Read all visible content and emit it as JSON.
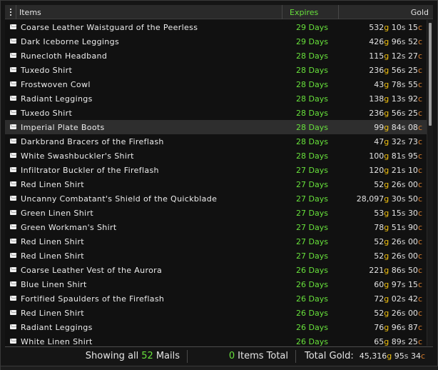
{
  "columns": {
    "items": "Items",
    "expires": "Expires",
    "gold": "Gold"
  },
  "rows": [
    {
      "name": "Coarse Leather Waistguard of the Peerless",
      "expires": "29 Days",
      "g": "532",
      "s": "10",
      "c": "15"
    },
    {
      "name": "Dark Iceborne Leggings",
      "expires": "29 Days",
      "g": "426",
      "s": "96",
      "c": "52"
    },
    {
      "name": "Runecloth Headband",
      "expires": "28 Days",
      "g": "115",
      "s": "12",
      "c": "27"
    },
    {
      "name": "Tuxedo Shirt",
      "expires": "28 Days",
      "g": "236",
      "s": "56",
      "c": "25"
    },
    {
      "name": "Frostwoven Cowl",
      "expires": "28 Days",
      "g": "43",
      "s": "78",
      "c": "55"
    },
    {
      "name": "Radiant Leggings",
      "expires": "28 Days",
      "g": "138",
      "s": "13",
      "c": "92"
    },
    {
      "name": "Tuxedo Shirt",
      "expires": "28 Days",
      "g": "236",
      "s": "56",
      "c": "25"
    },
    {
      "name": "Imperial Plate Boots",
      "expires": "28 Days",
      "g": "99",
      "s": "84",
      "c": "08",
      "selected": true
    },
    {
      "name": "Darkbrand Bracers of the Fireflash",
      "expires": "28 Days",
      "g": "47",
      "s": "32",
      "c": "73"
    },
    {
      "name": "White Swashbuckler's Shirt",
      "expires": "28 Days",
      "g": "100",
      "s": "81",
      "c": "95"
    },
    {
      "name": "Infiltrator Buckler of the Fireflash",
      "expires": "27 Days",
      "g": "120",
      "s": "21",
      "c": "10"
    },
    {
      "name": "Red Linen Shirt",
      "expires": "27 Days",
      "g": "52",
      "s": "26",
      "c": "00"
    },
    {
      "name": "Uncanny Combatant's Shield of the Quickblade",
      "expires": "27 Days",
      "g": "28,097",
      "s": "30",
      "c": "50"
    },
    {
      "name": "Green Linen Shirt",
      "expires": "27 Days",
      "g": "53",
      "s": "15",
      "c": "30"
    },
    {
      "name": "Green Workman's Shirt",
      "expires": "27 Days",
      "g": "78",
      "s": "51",
      "c": "90"
    },
    {
      "name": "Red Linen Shirt",
      "expires": "27 Days",
      "g": "52",
      "s": "26",
      "c": "00"
    },
    {
      "name": "Red Linen Shirt",
      "expires": "27 Days",
      "g": "52",
      "s": "26",
      "c": "00"
    },
    {
      "name": "Coarse Leather Vest of the Aurora",
      "expires": "26 Days",
      "g": "221",
      "s": "86",
      "c": "50"
    },
    {
      "name": "Blue Linen Shirt",
      "expires": "26 Days",
      "g": "60",
      "s": "97",
      "c": "15"
    },
    {
      "name": "Fortified Spaulders of the Fireflash",
      "expires": "26 Days",
      "g": "72",
      "s": "02",
      "c": "42"
    },
    {
      "name": "Red Linen Shirt",
      "expires": "26 Days",
      "g": "52",
      "s": "26",
      "c": "00"
    },
    {
      "name": "Radiant Leggings",
      "expires": "26 Days",
      "g": "76",
      "s": "96",
      "c": "87"
    },
    {
      "name": "White Linen Shirt",
      "expires": "26 Days",
      "g": "65",
      "s": "89",
      "c": "25"
    }
  ],
  "footer": {
    "showing_prefix": "Showing all",
    "mail_count": "52",
    "showing_suffix": "Mails",
    "items_count": "0",
    "items_suffix": "Items Total",
    "total_gold_label": "Total Gold:",
    "total_g": "45,316",
    "total_s": "95",
    "total_c": "34"
  },
  "currency": {
    "g": "g",
    "s": "s",
    "c": "c"
  },
  "colors": {
    "expires_green": "#67e03b",
    "gold": "#f0c010",
    "silver": "#cccccc",
    "copper": "#d27a2c"
  },
  "icons": {
    "mail": "envelope-icon",
    "grip": "drag-handle-icon"
  }
}
